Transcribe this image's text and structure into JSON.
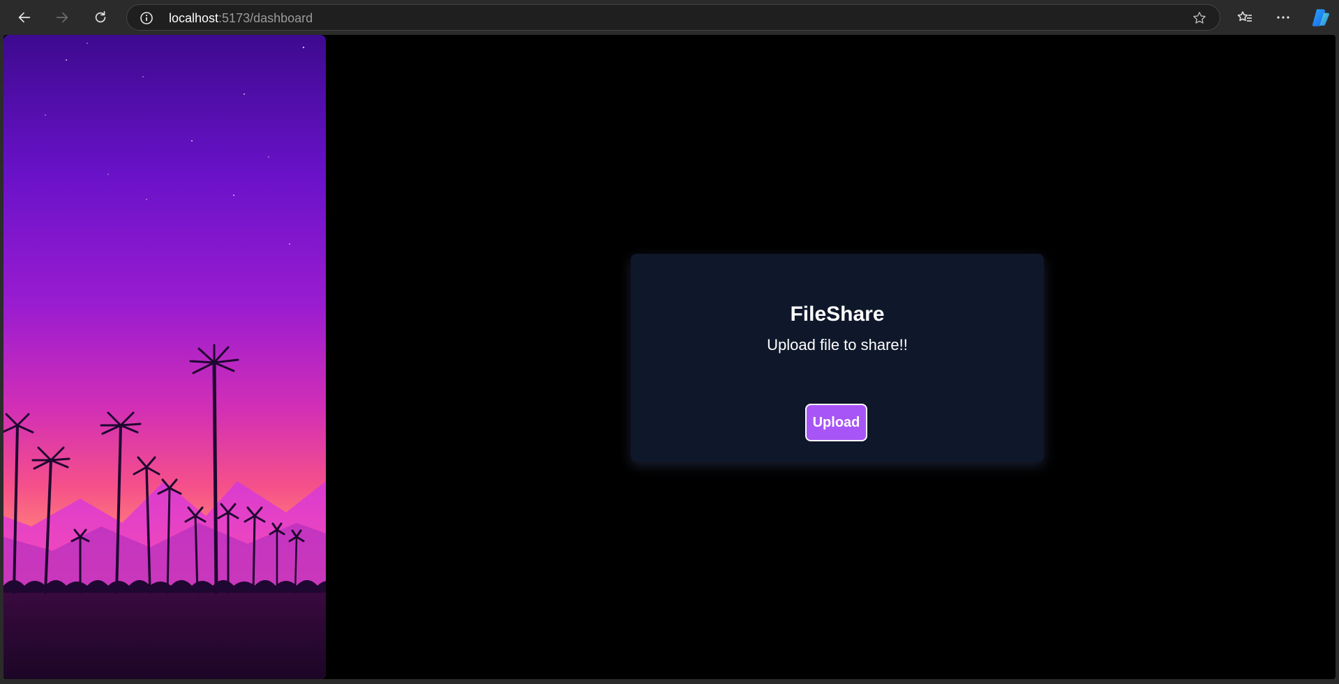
{
  "browser": {
    "url_host": "localhost",
    "url_rest": ":5173/dashboard",
    "icons": [
      "back-icon",
      "forward-icon",
      "reload-icon",
      "site-info-icon",
      "star-icon",
      "favorites-icon",
      "more-icon",
      "copilot-icon"
    ]
  },
  "card": {
    "title": "FileShare",
    "subtitle": "Upload file to share!!",
    "upload_label": "Upload"
  },
  "colors": {
    "card_bg": "#0f172a",
    "accent": "#a855f7",
    "page_bg": "#000000"
  }
}
